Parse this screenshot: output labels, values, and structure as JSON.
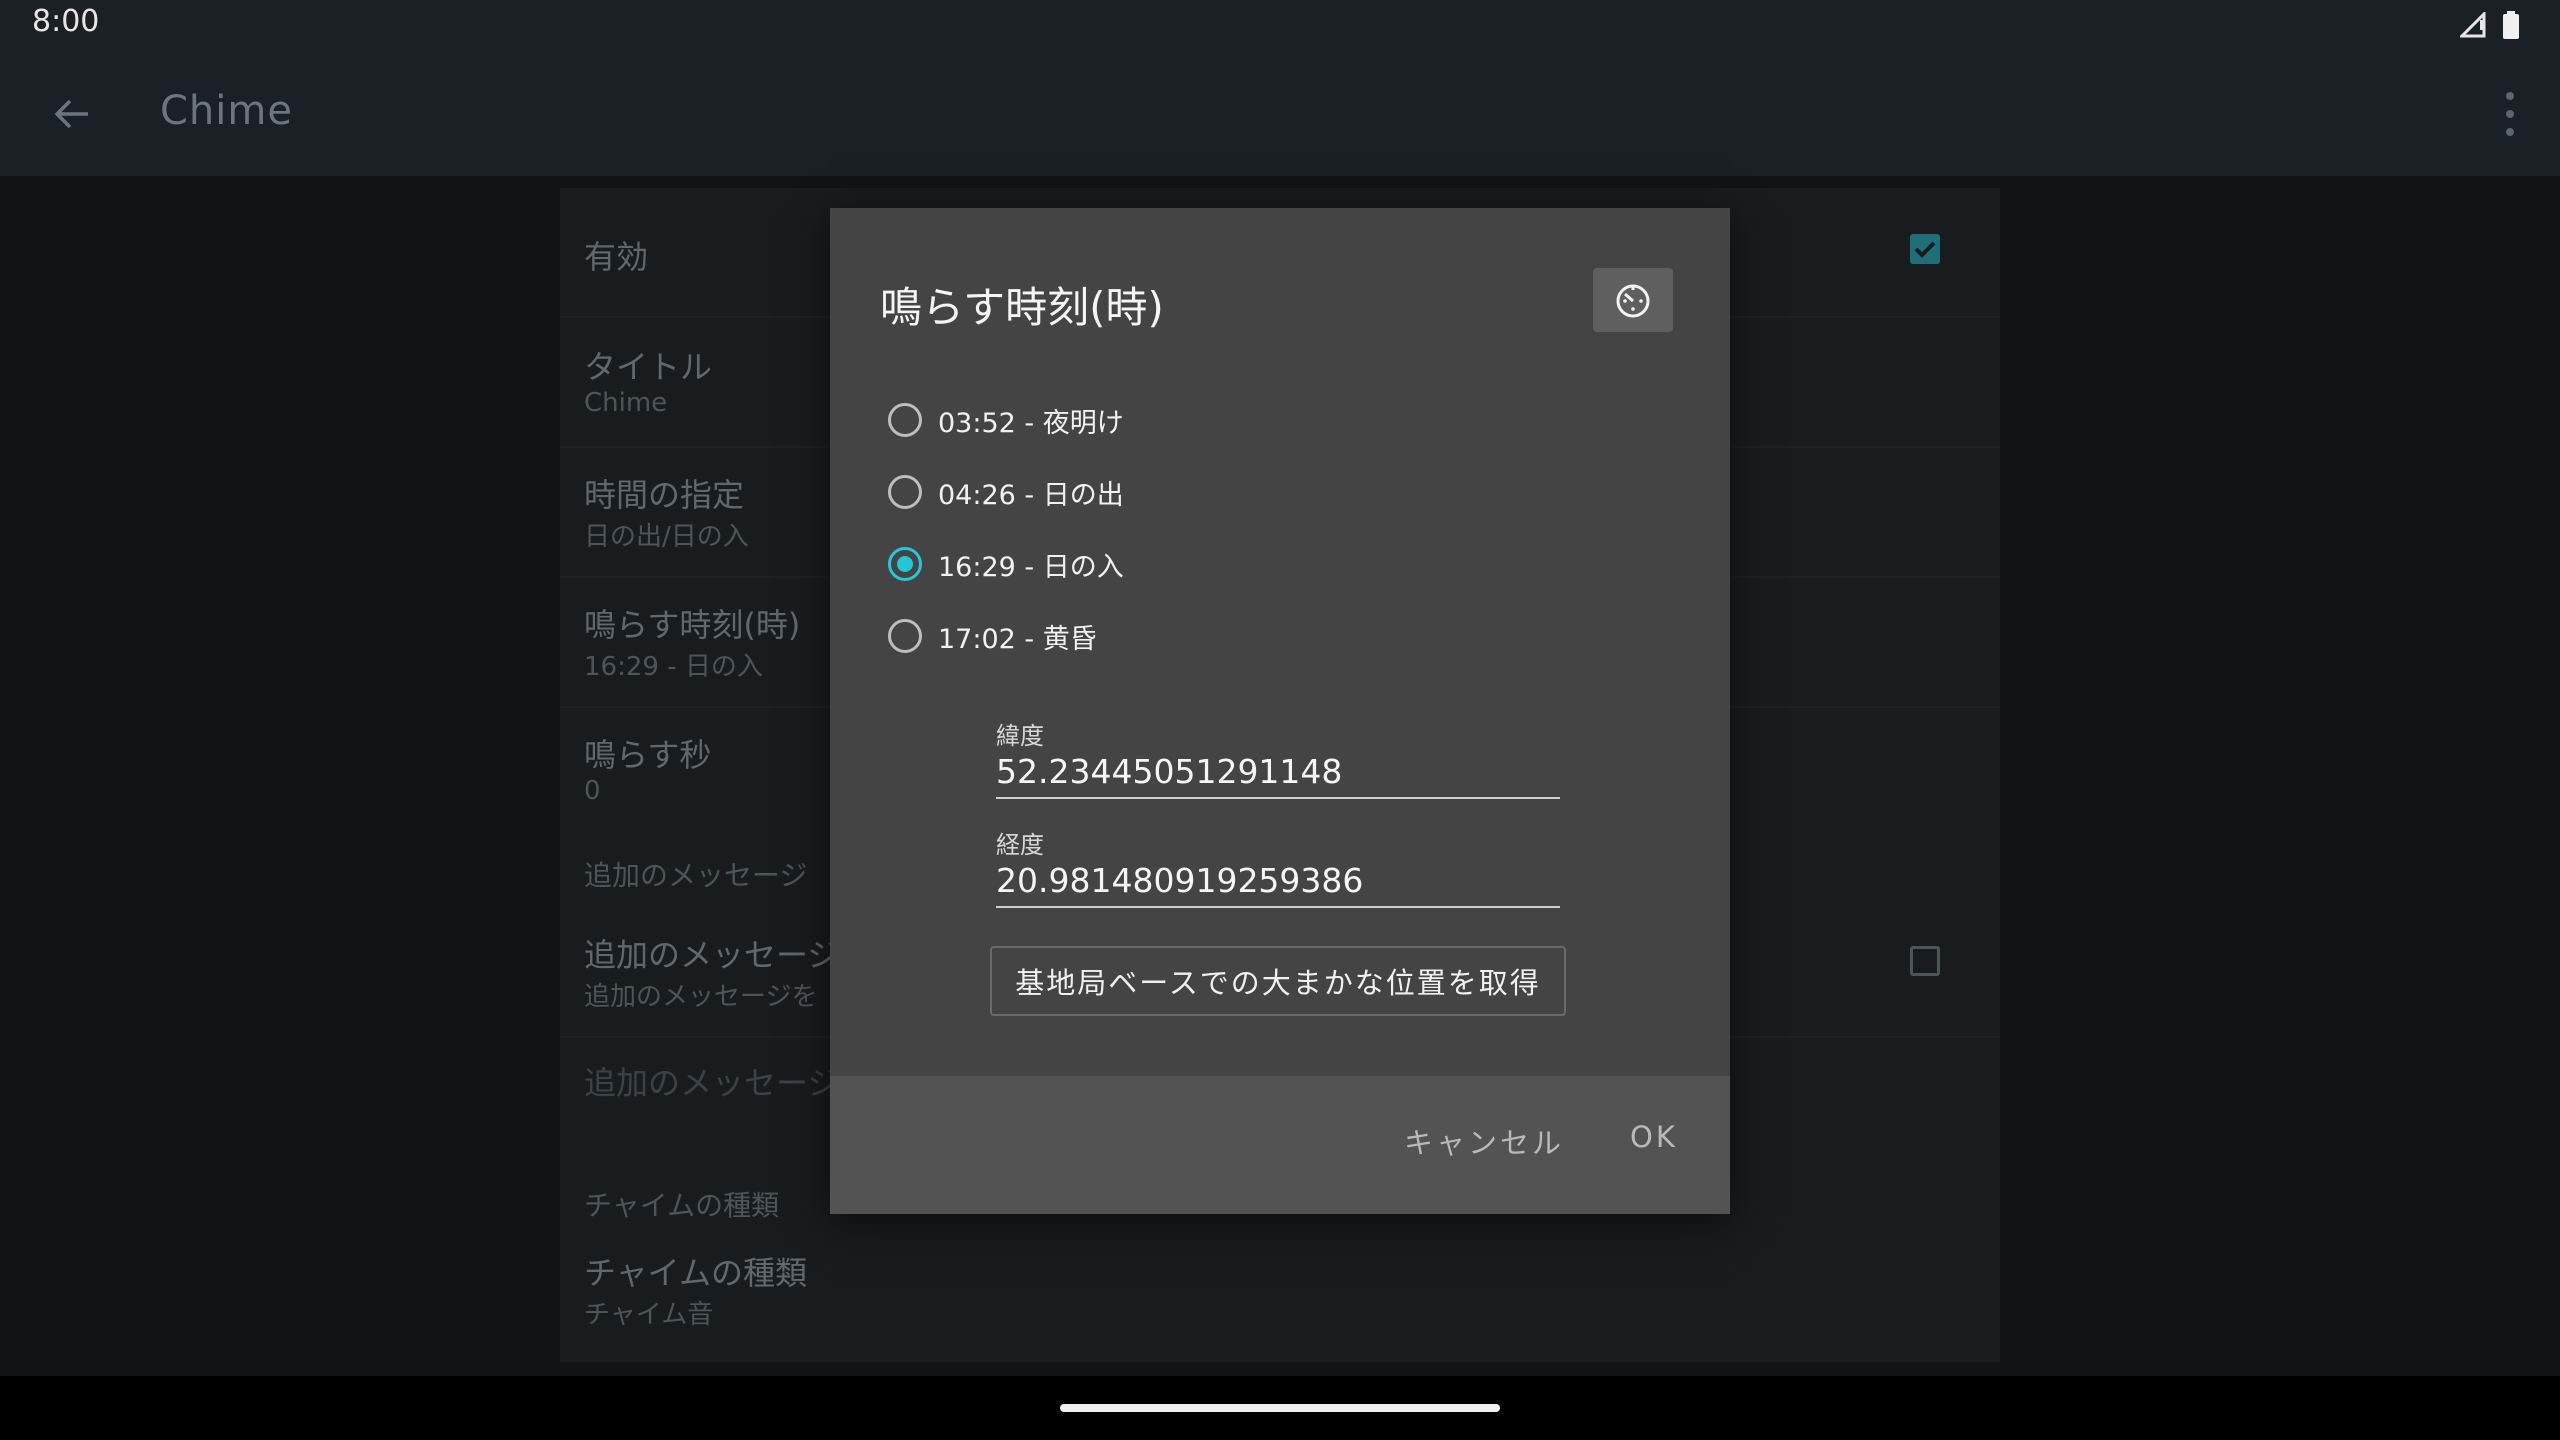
{
  "status_bar": {
    "time": "8:00"
  },
  "app_bar": {
    "title": "Chime"
  },
  "settings": {
    "enabled": {
      "title": "有効",
      "checked": true
    },
    "title_pref": {
      "title": "タイトル",
      "summary": "Chime"
    },
    "time_spec": {
      "title": "時間の指定",
      "summary": "日の出/日の入"
    },
    "ring_time": {
      "title": "鳴らす時刻(時)",
      "summary": "16:29 - 日の入"
    },
    "ring_seconds": {
      "title": "鳴らす秒",
      "summary": "0"
    },
    "category_extra_message": "追加のメッセージ",
    "extra_message": {
      "title": "追加のメッセージ",
      "summary": "追加のメッセージを",
      "checked": false
    },
    "extra_message_disabled": {
      "title": "追加のメッセージ"
    },
    "category_chime_type": "チャイムの種類",
    "chime_type": {
      "title": "チャイムの種類",
      "summary": "チャイム音"
    }
  },
  "dialog": {
    "title": "鳴らす時刻(時)",
    "timer_button_icon": "timer-icon",
    "options": [
      {
        "label": "03:52 - 夜明け",
        "selected": false
      },
      {
        "label": "04:26 - 日の出",
        "selected": false
      },
      {
        "label": "16:29 - 日の入",
        "selected": true
      },
      {
        "label": "17:02 - 黄昏",
        "selected": false
      }
    ],
    "latitude": {
      "label": "緯度",
      "value": "52.23445051291148"
    },
    "longitude": {
      "label": "経度",
      "value": "20.981480919259386"
    },
    "locate_button": "基地局ベースでの大まかな位置を取得",
    "cancel_button": "キャンセル",
    "ok_button": "OK"
  },
  "colors": {
    "accent": "#26c6da",
    "dialog_bg": "#444444",
    "appbar_bg": "#1b2024"
  }
}
